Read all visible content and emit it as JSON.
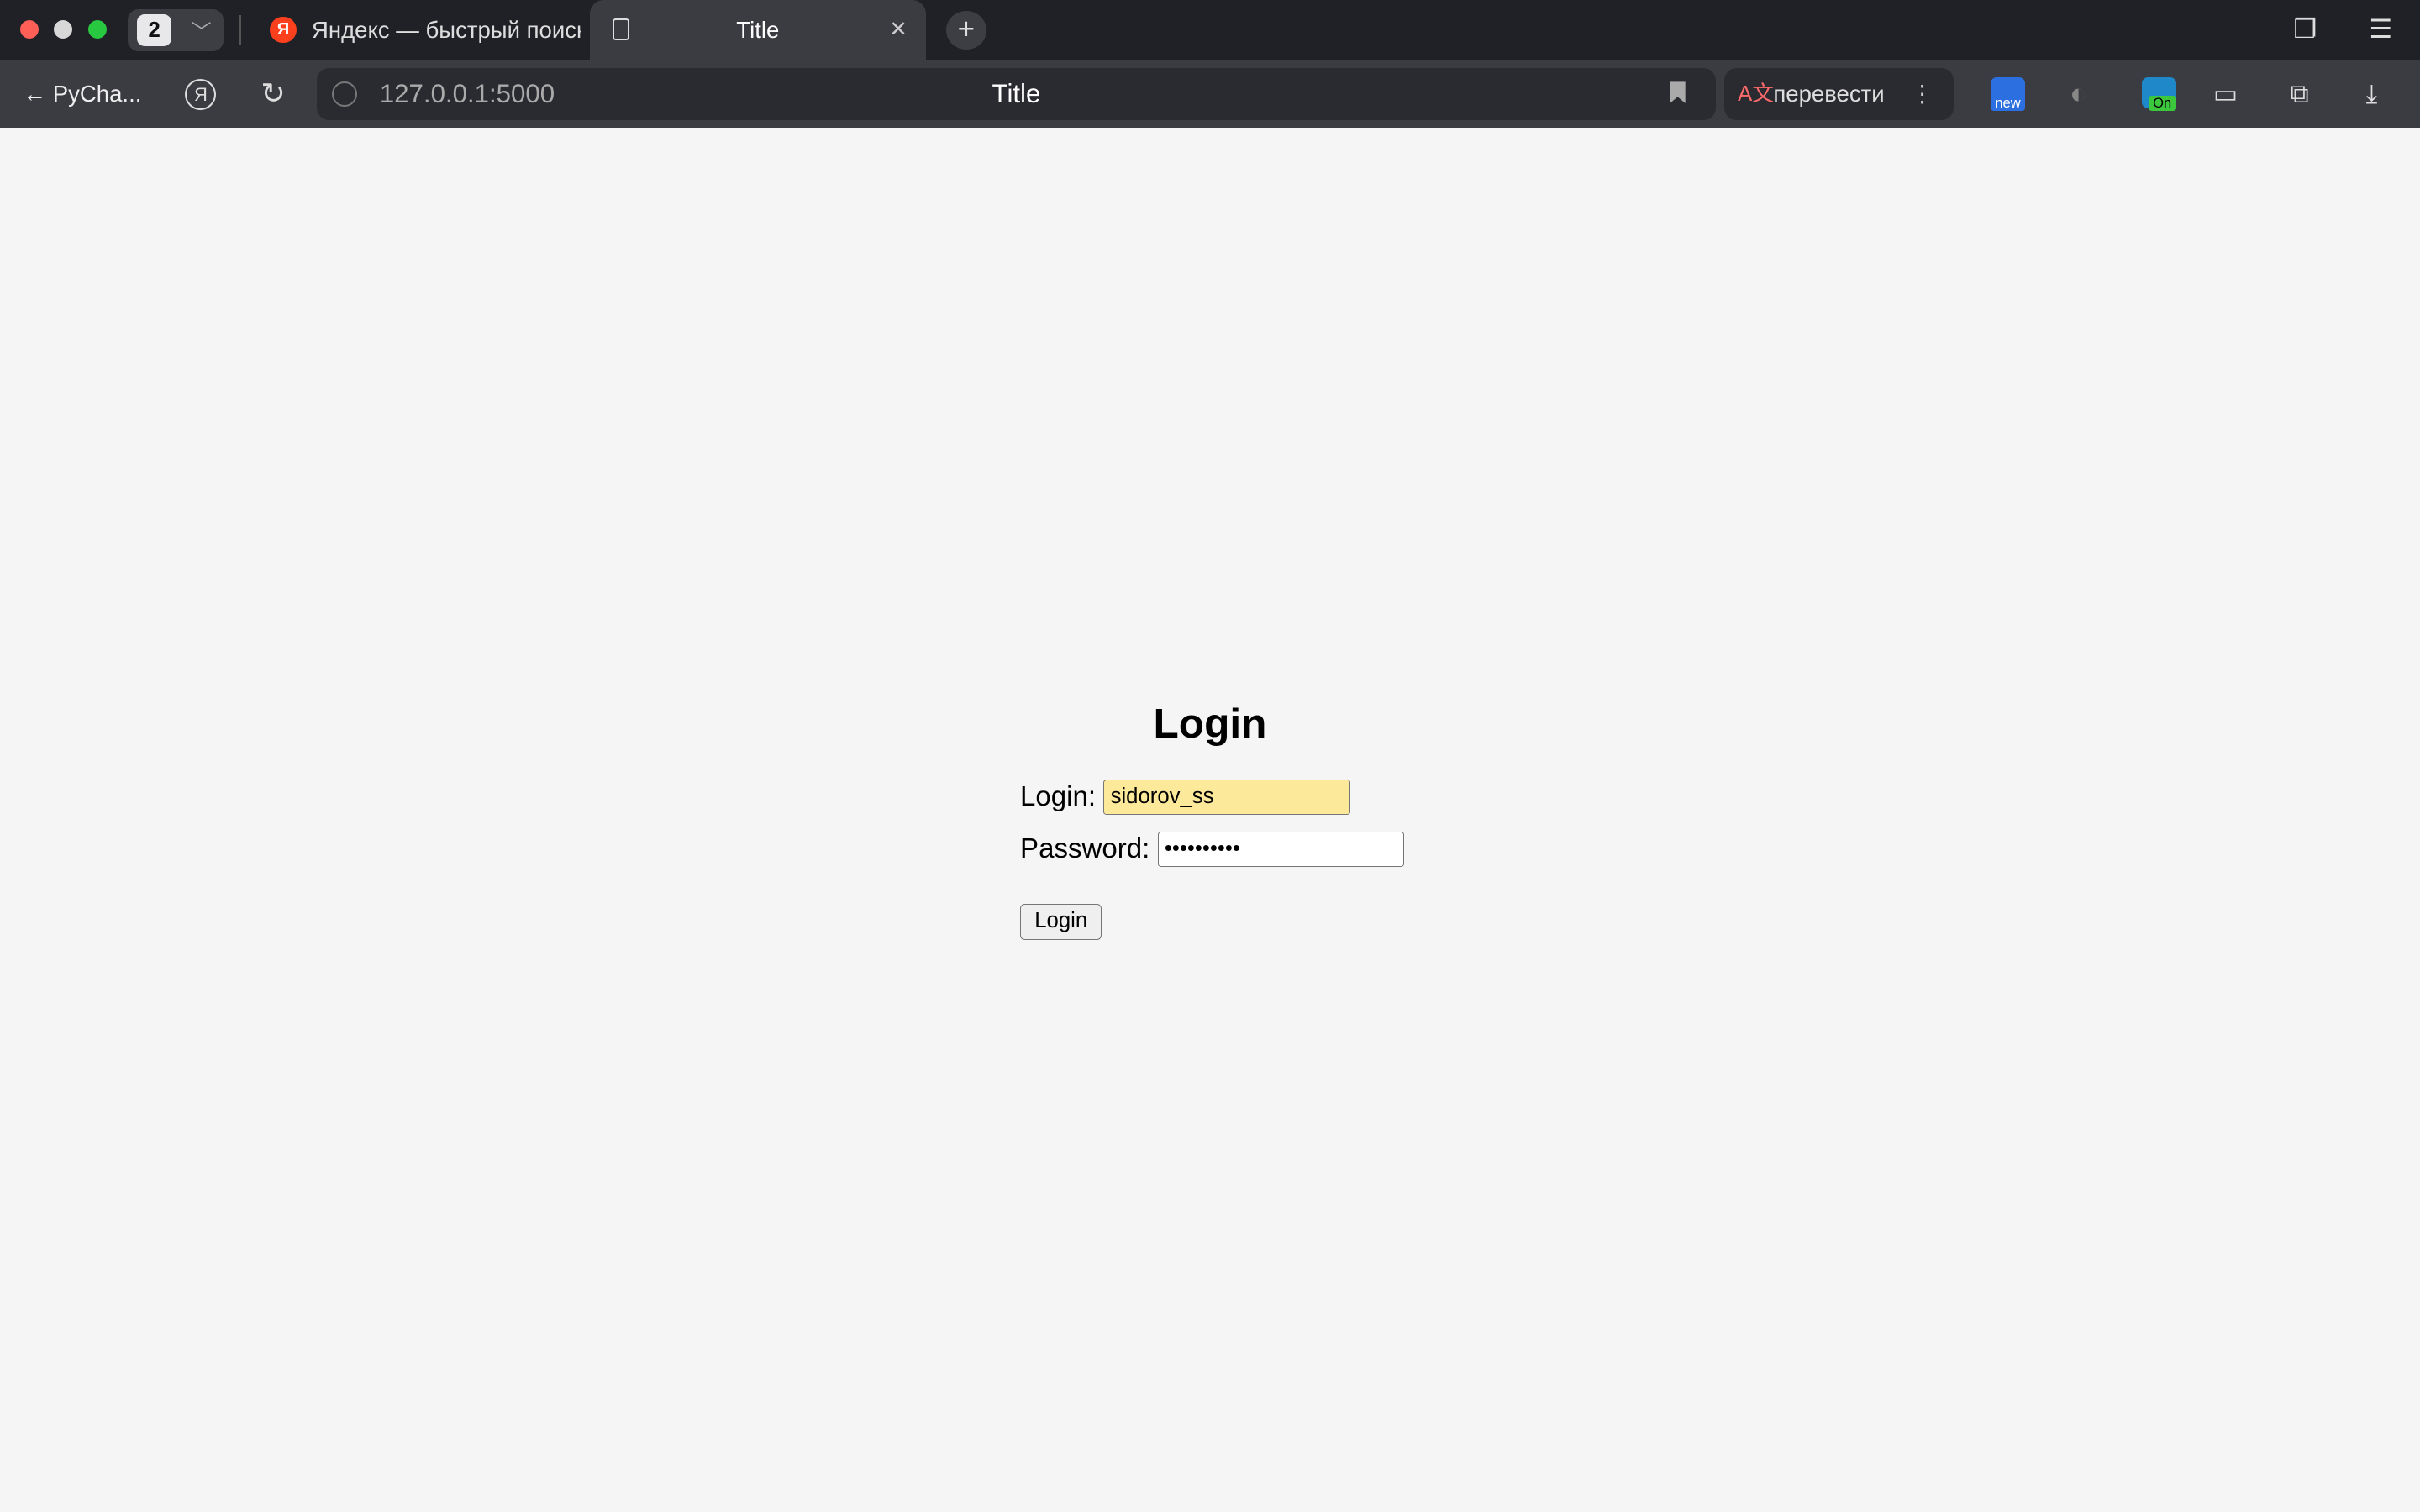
{
  "browser": {
    "tab_count": "2",
    "tabs": [
      {
        "label": "Яндекс — быстрый поиск",
        "favicon": "Я"
      },
      {
        "label": "Title",
        "close": "✕"
      }
    ],
    "new_tab": "+",
    "back_label": "PyCha...",
    "yandex_icon": "Я",
    "url": "127.0.0.1:5000",
    "url_title": "Title",
    "translate": {
      "label": "перевести",
      "more": "⋮"
    },
    "ext_new_badge": "new",
    "ext_on_badge": "On"
  },
  "page": {
    "heading": "Login",
    "login_label": "Login:",
    "login_value": "sidorov_ss",
    "password_label": "Password:",
    "password_value": "••••••••••",
    "submit_label": "Login"
  }
}
